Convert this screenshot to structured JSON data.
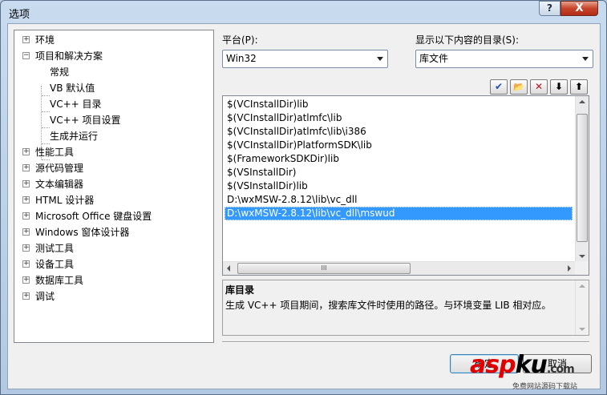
{
  "window": {
    "title": "选项",
    "help_label": "?",
    "close_label": "X"
  },
  "tree": [
    {
      "label": "环境",
      "expander": "+",
      "level": 0
    },
    {
      "label": "项目和解决方案",
      "expander": "−",
      "level": 0
    },
    {
      "label": "常规",
      "level": 1
    },
    {
      "label": "VB 默认值",
      "level": 1
    },
    {
      "label": "VC++ 目录",
      "level": 1
    },
    {
      "label": "VC++ 项目设置",
      "level": 1
    },
    {
      "label": "生成并运行",
      "level": 1
    },
    {
      "label": "性能工具",
      "expander": "+",
      "level": 0
    },
    {
      "label": "源代码管理",
      "expander": "+",
      "level": 0
    },
    {
      "label": "文本编辑器",
      "expander": "+",
      "level": 0
    },
    {
      "label": "HTML 设计器",
      "expander": "+",
      "level": 0
    },
    {
      "label": "Microsoft Office 键盘设置",
      "expander": "+",
      "level": 0
    },
    {
      "label": "Windows 窗体设计器",
      "expander": "+",
      "level": 0
    },
    {
      "label": "测试工具",
      "expander": "+",
      "level": 0
    },
    {
      "label": "设备工具",
      "expander": "+",
      "level": 0
    },
    {
      "label": "数据库工具",
      "expander": "+",
      "level": 0
    },
    {
      "label": "调试",
      "expander": "+",
      "level": 0
    }
  ],
  "platform": {
    "label": "平台(P):",
    "value": "Win32"
  },
  "dirs": {
    "label": "显示以下内容的目录(S):",
    "value": "库文件"
  },
  "toolbar": {
    "new_line_icon": "✔",
    "folder_icon": "📂",
    "delete_icon": "✕",
    "move_down_icon": "⬇",
    "move_up_icon": "⬆"
  },
  "list": {
    "items": [
      "$(VCInstallDir)lib",
      "$(VCInstallDir)atlmfc\\lib",
      "$(VCInstallDir)atlmfc\\lib\\i386",
      "$(VCInstallDir)PlatformSDK\\lib",
      "$(FrameworkSDKDir)lib",
      "$(VSInstallDir)",
      "$(VSInstallDir)lib",
      "D:\\wxMSW-2.8.12\\lib\\vc_dll",
      "D:\\wxMSW-2.8.12\\lib\\vc_dll\\mswud"
    ],
    "selected_index": 8,
    "hscroll_grip": "III"
  },
  "description": {
    "title": "库目录",
    "text": "生成 VC++ 项目期间，搜索库文件时使用的路径。与环境变量 LIB 相对应。"
  },
  "buttons": {
    "ok": "确定",
    "cancel": "取消"
  },
  "watermark": {
    "main_red": "asp",
    "main_black": "ku",
    "suffix": ".com",
    "sub": "免费网站源码下载站"
  },
  "colors": {
    "selection": "#3399ff",
    "watermark_red": "#e00000",
    "close_red": "#c7442b"
  }
}
